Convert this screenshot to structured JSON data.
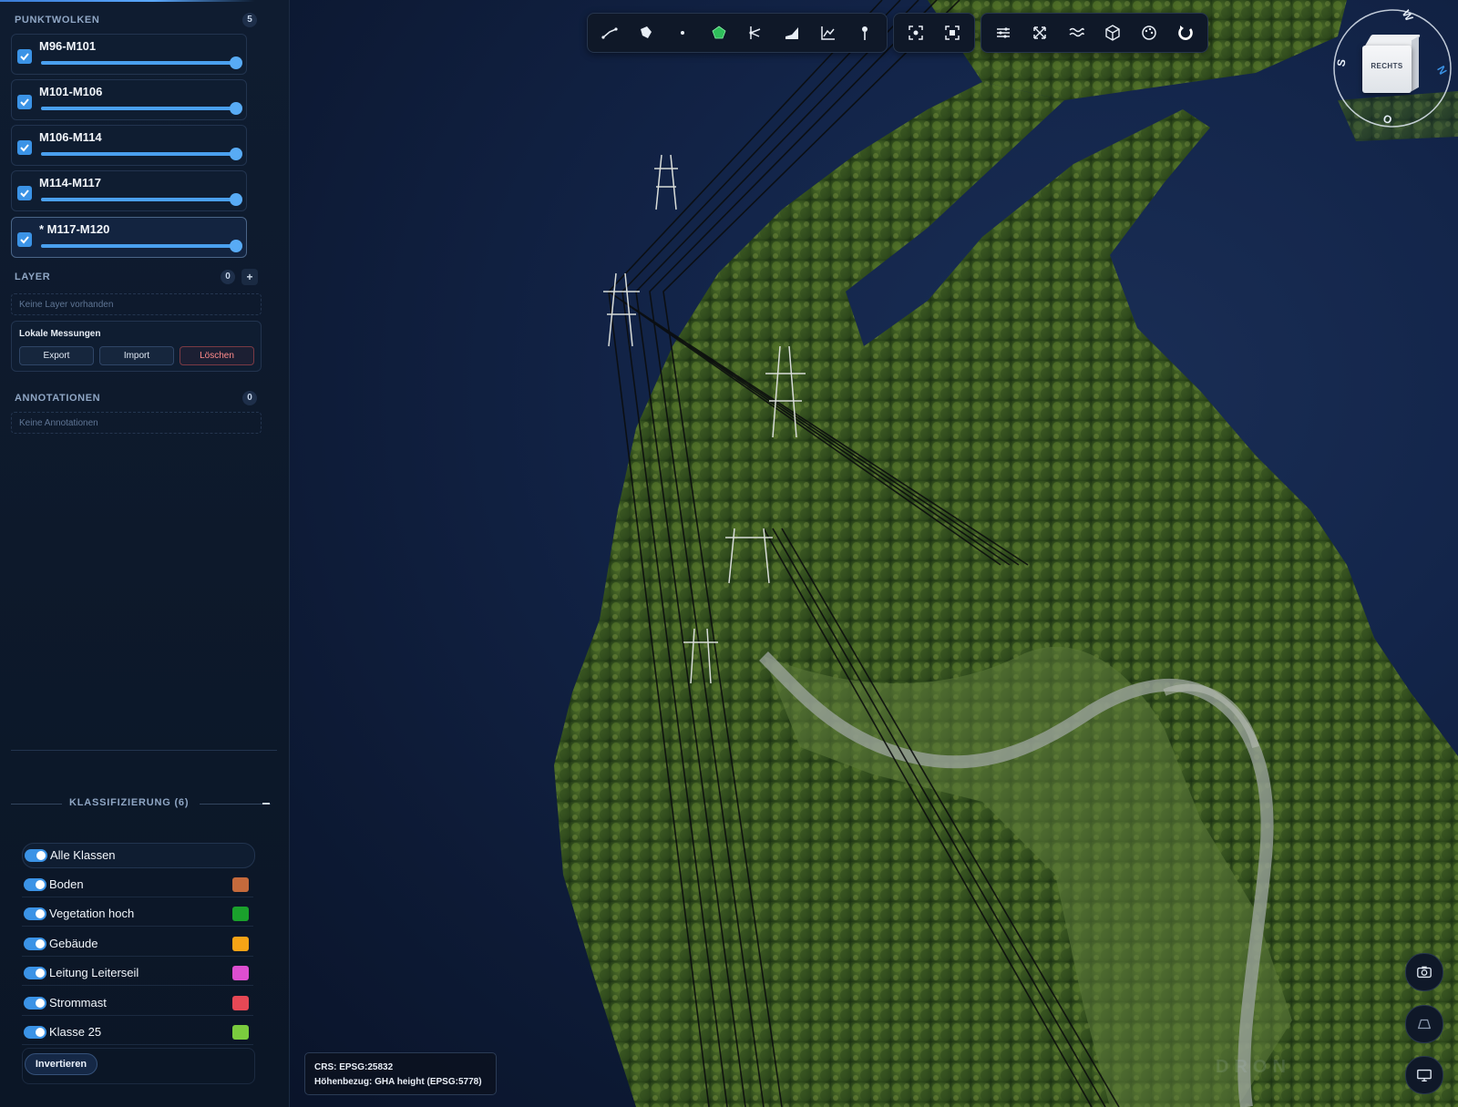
{
  "punktwolken": {
    "title": "PUNKTWOLKEN",
    "count": "5",
    "items": [
      {
        "name": "M96-M101",
        "opacity": 1.0,
        "checked": true
      },
      {
        "name": "M101-M106",
        "opacity": 1.0,
        "checked": true
      },
      {
        "name": "M106-M114",
        "opacity": 1.0,
        "checked": true
      },
      {
        "name": "M114-M117",
        "opacity": 1.0,
        "checked": true
      },
      {
        "name": "* M117-M120",
        "opacity": 1.0,
        "checked": true
      }
    ]
  },
  "layer": {
    "title": "LAYER",
    "count": "0",
    "add_label": "+",
    "empty_text": "Keine Layer vorhanden"
  },
  "lokale_messungen": {
    "title": "Lokale Messungen",
    "export_label": "Export",
    "import_label": "Import",
    "delete_label": "Löschen"
  },
  "annotationen": {
    "title": "ANNOTATIONEN",
    "count": "0",
    "empty_text": "Keine Annotationen"
  },
  "klassifizierung": {
    "title": "KLASSIFIZIERUNG (6)",
    "items": [
      {
        "label": "Alle Klassen",
        "on": true,
        "color": ""
      },
      {
        "label": "Boden",
        "on": true,
        "color": "#c56a3c"
      },
      {
        "label": "Vegetation hoch",
        "on": true,
        "color": "#1aa12c"
      },
      {
        "label": "Gebäude",
        "on": true,
        "color": "#f7a316"
      },
      {
        "label": "Leitung Leiterseil",
        "on": true,
        "color": "#dd4ed0"
      },
      {
        "label": "Strommast",
        "on": true,
        "color": "#e64855"
      },
      {
        "label": "Klasse 25",
        "on": true,
        "color": "#7acb3e"
      }
    ],
    "invert_label": "Invertieren"
  },
  "toolbar": {
    "groups": [
      [
        "distance-measure-icon",
        "area-polygon-icon",
        "point-icon",
        "polygon-icon",
        "angle-icon",
        "height-profile-icon",
        "line-chart-icon",
        "pin-icon"
      ],
      [
        "focus-icon",
        "frame-icon"
      ],
      [
        "sliders-icon",
        "arrows-icon",
        "waves-icon",
        "cube-icon",
        "palette-icon",
        "rotate-icon"
      ]
    ]
  },
  "compass": {
    "north": "N",
    "east": "O",
    "south": "S",
    "west": "W",
    "cube_face": "RECHTS"
  },
  "crs": {
    "line1": "CRS: EPSG:25832",
    "line2": "Höhenbezug: GHA height (EPSG:5778)"
  },
  "watermark": "DRON",
  "side_buttons": [
    "camera-icon",
    "perspective-icon",
    "screen-icon"
  ]
}
